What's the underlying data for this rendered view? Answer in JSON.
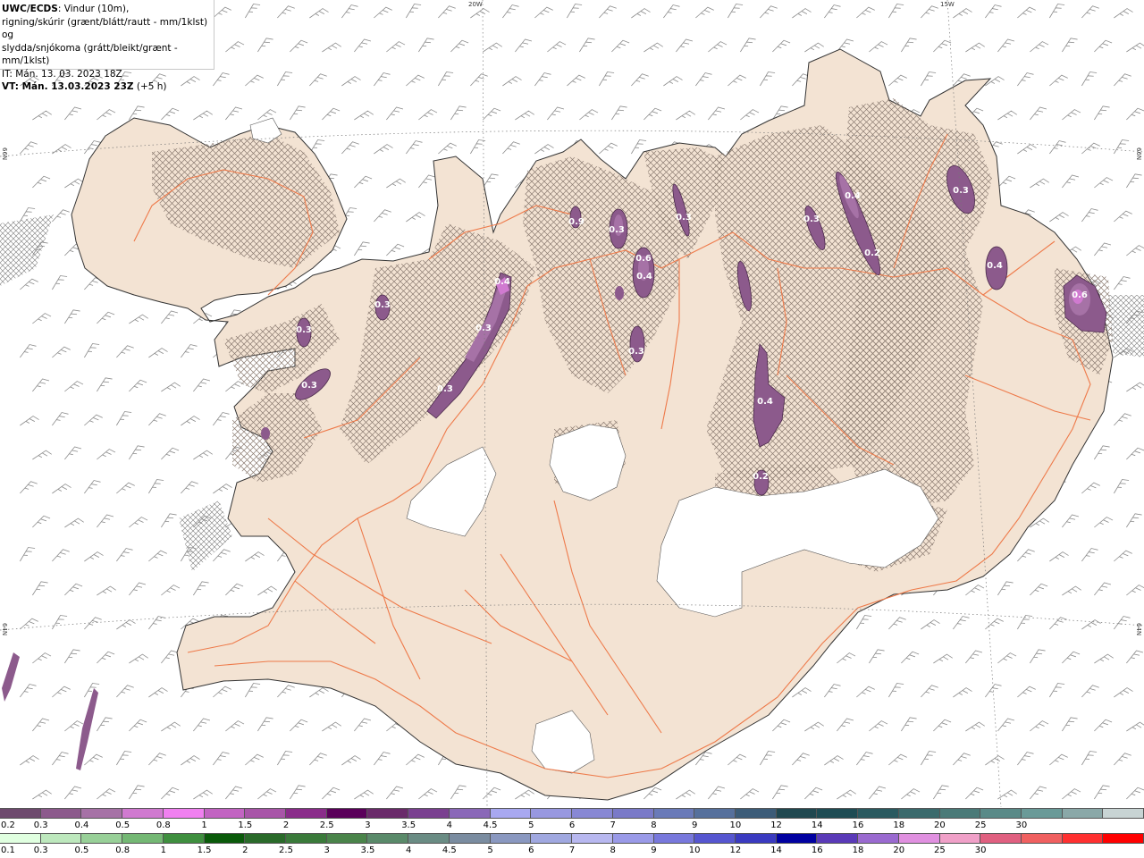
{
  "header": {
    "model": "UWC/ECDS",
    "line1_rest": ": Vindur (10m),",
    "line2": "rigning/skúrir (grænt/blátt/rautt - mm/1klst) og",
    "line3": "slydda/snjókoma (grátt/bleikt/grænt - mm/1klst)",
    "line4": "IT: Mán. 13. 03. 2023 18Z",
    "vt_label": "VT: Mán. 13.03.2023 23Z",
    "vt_offset": " (+5 h)"
  },
  "grid_labels": {
    "lon_20w": "20W",
    "lon_15w": "15W",
    "lat_66n_left": "66N",
    "lat_66n_right": "66N",
    "lat_64n_left": "64N",
    "lat_64n_right": "64N"
  },
  "snow_scale": {
    "colors": [
      "#6e4a6e",
      "#8c5a8c",
      "#a672a6",
      "#d07ad0",
      "#f080f0",
      "#c264c2",
      "#a855a8",
      "#8a2c8a",
      "#5a005a",
      "#6a2a6a",
      "#7a4090",
      "#8a68b8",
      "#a8a8f0",
      "#9898e0",
      "#8888d4",
      "#7a7ac8",
      "#6a7ab8",
      "#56709c",
      "#3c5c78",
      "#204850",
      "#1e4c54",
      "#2a5a60",
      "#3a6a6c",
      "#4a7a78",
      "#5a8a88",
      "#6a9a98",
      "#8aa8a8",
      "#c8d4d4"
    ],
    "labels": [
      "0.2",
      "0.3",
      "0.4",
      "0.5",
      "0.8",
      "1",
      "1.5",
      "2",
      "2.5",
      "3",
      "3.5",
      "4",
      "4.5",
      "5",
      "6",
      "7",
      "8",
      "9",
      "10",
      "12",
      "14",
      "16",
      "18",
      "20",
      "25",
      "30"
    ]
  },
  "rain_scale": {
    "colors": [
      "#e0ffe0",
      "#bde8bd",
      "#98d098",
      "#74b874",
      "#3f8f3f",
      "#0a5a0a",
      "#2a6a2a",
      "#3a7a3a",
      "#4a844a",
      "#5a8a6a",
      "#6a8c84",
      "#7a8ca0",
      "#8a98c0",
      "#a0a8e0",
      "#b8b8f0",
      "#9a9ae8",
      "#7878dc",
      "#5656d0",
      "#3a3ac0",
      "#0000a0",
      "#5a3ab8",
      "#9a6ad0",
      "#e090e0",
      "#f0a0c8",
      "#e06080",
      "#f06060",
      "#ff3030",
      "#ff0000"
    ],
    "labels": [
      "0.1",
      "0.3",
      "0.5",
      "0.8",
      "1",
      "1.5",
      "2",
      "2.5",
      "3",
      "3.5",
      "4",
      "4.5",
      "5",
      "6",
      "7",
      "8",
      "9",
      "10",
      "12",
      "14",
      "16",
      "18",
      "20",
      "25",
      "30"
    ]
  },
  "contour_labels": [
    "0.3",
    "0.3",
    "0.3",
    "0.3",
    "0.3",
    "0.4",
    "0.9",
    "0.3",
    "0.6",
    "0.4",
    "0.3",
    "0.3",
    "0.4",
    "0.3",
    "0.2",
    "0.3",
    "0.4",
    "0.6",
    "0.4",
    "0.2"
  ]
}
